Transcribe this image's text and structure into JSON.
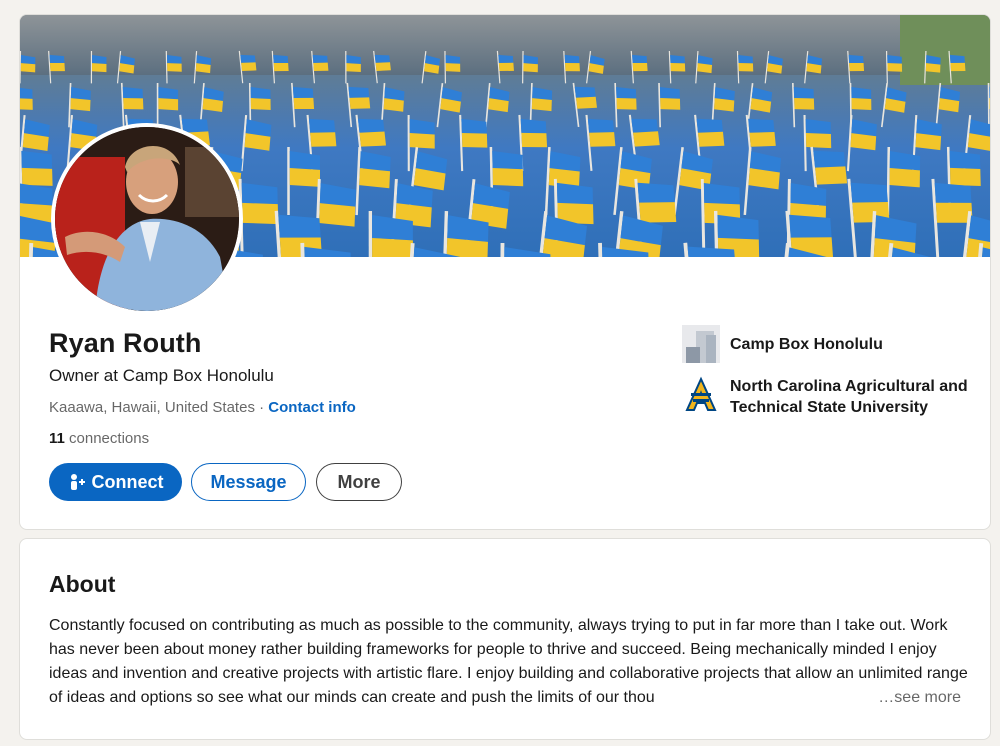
{
  "profile": {
    "name": "Ryan Routh",
    "headline": "Owner at Camp Box Honolulu",
    "location": "Kaaawa, Hawaii, United States",
    "separator": " · ",
    "contact_info_label": "Contact info",
    "connections_count": "11",
    "connections_label": " connections"
  },
  "actions": {
    "connect_label": "Connect",
    "message_label": "Message",
    "more_label": "More"
  },
  "organizations": [
    {
      "name": "Camp Box Honolulu",
      "logo_icon": "company-placeholder-icon"
    },
    {
      "name": "North Carolina Agricultural and Technical State University",
      "logo_icon": "ncat-aggie-logo-icon"
    }
  ],
  "about": {
    "title": "About",
    "text": "Constantly focused on contributing as much as possible to the community, always trying to put in far more than I take out. Work has never been about money rather building frameworks for people to thrive and succeed. Being mechanically minded I enjoy ideas and invention and creative projects with artistic flare. I enjoy building and collaborative projects that allow an unlimited range of ideas and options so see what our minds can create and push the limits of our thou",
    "see_more_label": "…see more"
  },
  "colors": {
    "brand_blue": "#0a66c2",
    "page_background": "#f4f2ee",
    "flag_blue": "#2f7fd6",
    "flag_yellow": "#f2c52a"
  }
}
